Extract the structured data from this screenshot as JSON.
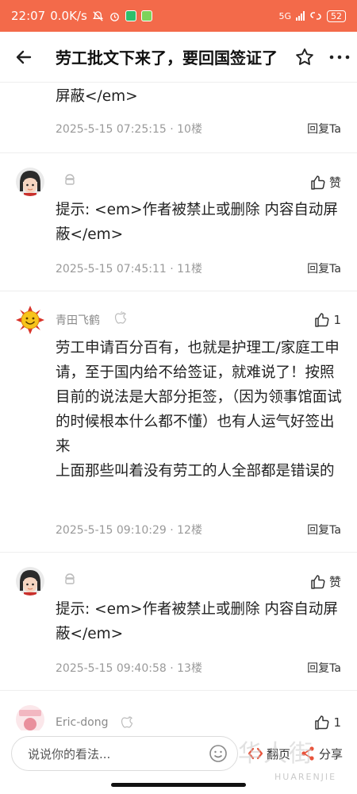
{
  "status": {
    "time": "22:07",
    "speed": "0.0K/s",
    "network": "5G",
    "battery": "52"
  },
  "header": {
    "title": "劳工批文下来了，要回国签证了"
  },
  "posts": [
    {
      "body": "屏蔽</em>",
      "time": "2025-5-15 07:25:15",
      "floor": "10楼",
      "reply": "回复Ta"
    },
    {
      "username": "",
      "platform_icon": "android-icon",
      "like_label": "赞",
      "body": "提示: <em>作者被禁止或删除 内容自动屏蔽</em>",
      "time": "2025-5-15 07:45:11",
      "floor": "11楼",
      "reply": "回复Ta"
    },
    {
      "username": "青田飞鹤",
      "platform_icon": "apple-icon",
      "like_label": "1",
      "body": "劳工申请百分百有，也就是护理工/家庭工申请，至于国内给不给签证，就难说了！按照目前的说法是大部分拒签，（因为领事馆面试的时候根本什么都不懂）也有人运气好签出来\n上面那些叫着没有劳工的人全部都是错误的",
      "time": "2025-5-15 09:10:29",
      "floor": "12楼",
      "reply": "回复Ta"
    },
    {
      "username": "",
      "platform_icon": "android-icon",
      "like_label": "赞",
      "body": "提示: <em>作者被禁止或删除 内容自动屏蔽</em>",
      "time": "2025-5-15 09:40:58",
      "floor": "13楼",
      "reply": "回复Ta"
    },
    {
      "username": "Eric-dong",
      "platform_icon": "apple-icon",
      "like_label": "1"
    }
  ],
  "bottom": {
    "placeholder": "说说你的看法...",
    "page_label": "翻页",
    "share_label": "分享"
  },
  "watermark": {
    "text": "华人街",
    "sub": "HUARENJIE"
  },
  "colors": {
    "statusbar": "#f36a4a",
    "meta": "#9a9a9a"
  }
}
